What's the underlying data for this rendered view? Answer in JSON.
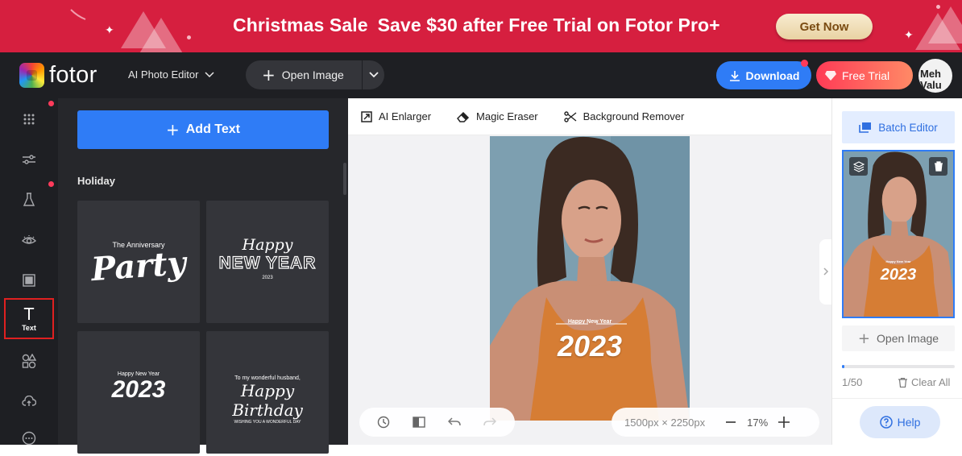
{
  "banner": {
    "title_part1": "Christmas Sale",
    "title_part2": "Save $30 after Free Trial on Fotor Pro+",
    "cta": "Get Now",
    "color": "#d61f3f"
  },
  "header": {
    "logo_text": "fotor",
    "editor_menu": "AI Photo Editor",
    "open_image": "Open Image",
    "download": "Download",
    "free_trial": "Free Trial",
    "avatar_text": "Meh\nValu"
  },
  "left_nav": {
    "active_label": "Text",
    "items": [
      "templates-icon",
      "adjust-icon",
      "effects-icon",
      "beauty-icon",
      "frames-icon",
      "text",
      "elements-icon",
      "cloud-icon",
      "more-icon"
    ]
  },
  "text_panel": {
    "add_text": "Add Text",
    "section": "Holiday",
    "cards": [
      {
        "small": "The Anniversary",
        "big": "Party"
      },
      {
        "small": "Happy",
        "big": "NEW YEAR",
        "sub": "2023"
      },
      {
        "small": "Happy New Year",
        "big": "2023"
      },
      {
        "small": "To my wonderful husband,",
        "big": "Happy Birthday",
        "sub": "WISHING YOU A WONDERFUL DAY"
      }
    ]
  },
  "toolbar": {
    "ai_enlarger": "AI Enlarger",
    "magic_eraser": "Magic Eraser",
    "background_remover": "Background Remover"
  },
  "canvas": {
    "overlay_small": "Happy New Year",
    "overlay_big": "2023",
    "dimensions": "1500px × 2250px",
    "zoom": "17%"
  },
  "right_panel": {
    "batch_editor": "Batch Editor",
    "thumb_overlay_small": "Happy New Year",
    "thumb_overlay_big": "2023",
    "open_image": "Open Image",
    "count": "1/50",
    "progress": 0.02,
    "clear_all": "Clear All",
    "help": "Help"
  },
  "colors": {
    "accent": "#2f7cf6",
    "dark_bg": "#1e1f23",
    "panel_bg": "#26272b",
    "card_bg": "#34353a",
    "active_outline": "#e02020"
  }
}
